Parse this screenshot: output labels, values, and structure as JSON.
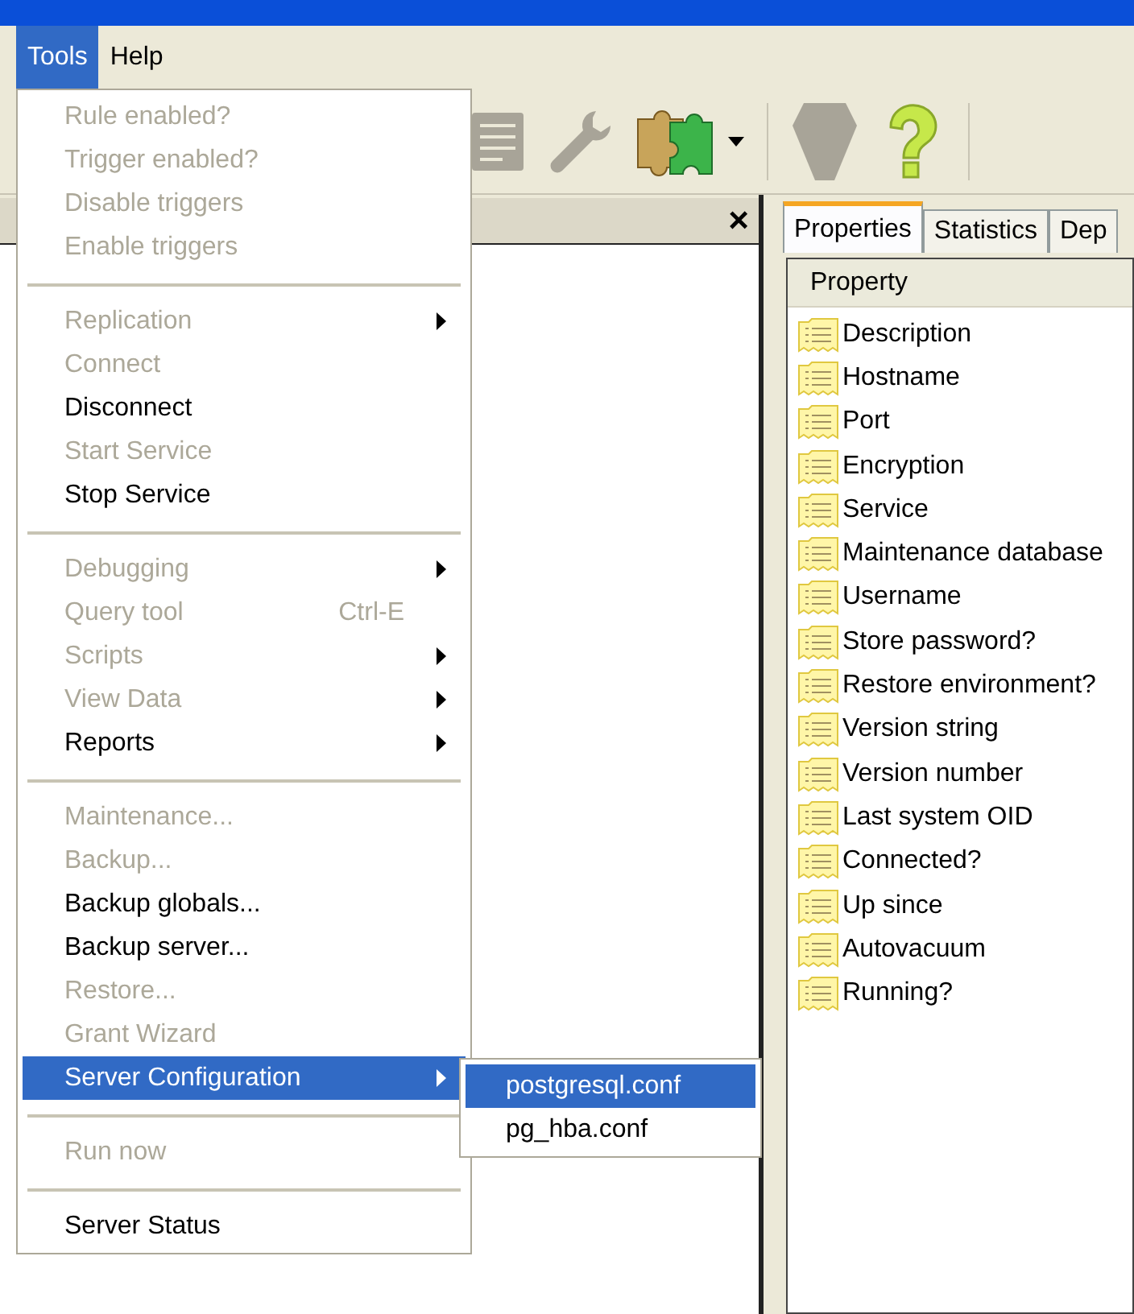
{
  "menu_bar": [
    {
      "label": "Tools",
      "selected": true
    },
    {
      "label": "Help",
      "selected": false
    }
  ],
  "left_panel": {
    "close": "×"
  },
  "tools_menu": {
    "groups": [
      [
        {
          "label": "Rule enabled?",
          "disabled": true,
          "submenu": false,
          "selected": false
        },
        {
          "label": "Trigger enabled?",
          "disabled": true,
          "submenu": false,
          "selected": false
        },
        {
          "label": "Disable triggers",
          "disabled": true,
          "submenu": false,
          "selected": false
        },
        {
          "label": "Enable triggers",
          "disabled": true,
          "submenu": false,
          "selected": false
        }
      ],
      [
        {
          "label": "Replication",
          "disabled": true,
          "submenu": true,
          "selected": false
        },
        {
          "label": "Connect",
          "disabled": true,
          "submenu": false,
          "selected": false
        },
        {
          "label": "Disconnect",
          "disabled": false,
          "submenu": false,
          "selected": false
        },
        {
          "label": "Start Service",
          "disabled": true,
          "submenu": false,
          "selected": false
        },
        {
          "label": "Stop Service",
          "disabled": false,
          "submenu": false,
          "selected": false
        }
      ],
      [
        {
          "label": "Debugging",
          "disabled": true,
          "submenu": true,
          "selected": false
        },
        {
          "label": "Query tool",
          "shortcut": "Ctrl-E",
          "disabled": true,
          "submenu": false,
          "selected": false
        },
        {
          "label": "Scripts",
          "disabled": true,
          "submenu": true,
          "selected": false
        },
        {
          "label": "View Data",
          "disabled": true,
          "submenu": true,
          "selected": false
        },
        {
          "label": "Reports",
          "disabled": false,
          "submenu": true,
          "selected": false
        }
      ],
      [
        {
          "label": "Maintenance...",
          "disabled": true,
          "submenu": false,
          "selected": false
        },
        {
          "label": "Backup...",
          "disabled": true,
          "submenu": false,
          "selected": false
        },
        {
          "label": "Backup globals...",
          "disabled": false,
          "submenu": false,
          "selected": false
        },
        {
          "label": "Backup server...",
          "disabled": false,
          "submenu": false,
          "selected": false
        },
        {
          "label": "Restore...",
          "disabled": true,
          "submenu": false,
          "selected": false
        },
        {
          "label": "Grant Wizard",
          "disabled": true,
          "submenu": false,
          "selected": false
        },
        {
          "label": "Server Configuration",
          "disabled": false,
          "submenu": true,
          "selected": true
        }
      ],
      [
        {
          "label": "Run now",
          "disabled": true,
          "submenu": false,
          "selected": false
        }
      ],
      [
        {
          "label": "Server Status",
          "disabled": false,
          "submenu": false,
          "selected": false
        }
      ]
    ]
  },
  "submenu": {
    "items": [
      {
        "label": "postgresql.conf",
        "selected": true
      },
      {
        "label": "pg_hba.conf",
        "selected": false
      }
    ]
  },
  "properties_panel": {
    "tabs": [
      {
        "label": "Properties",
        "selected": true
      },
      {
        "label": "Statistics",
        "selected": false
      },
      {
        "label": "Dep",
        "selected": false
      }
    ],
    "column": "Property",
    "rows": [
      "Description",
      "Hostname",
      "Port",
      "Encryption",
      "Service",
      "Maintenance database",
      "Username",
      "Store password?",
      "Restore environment?",
      "Version string",
      "Version number",
      "Last system OID",
      "Connected?",
      "Up since",
      "Autovacuum",
      "Running?"
    ]
  }
}
